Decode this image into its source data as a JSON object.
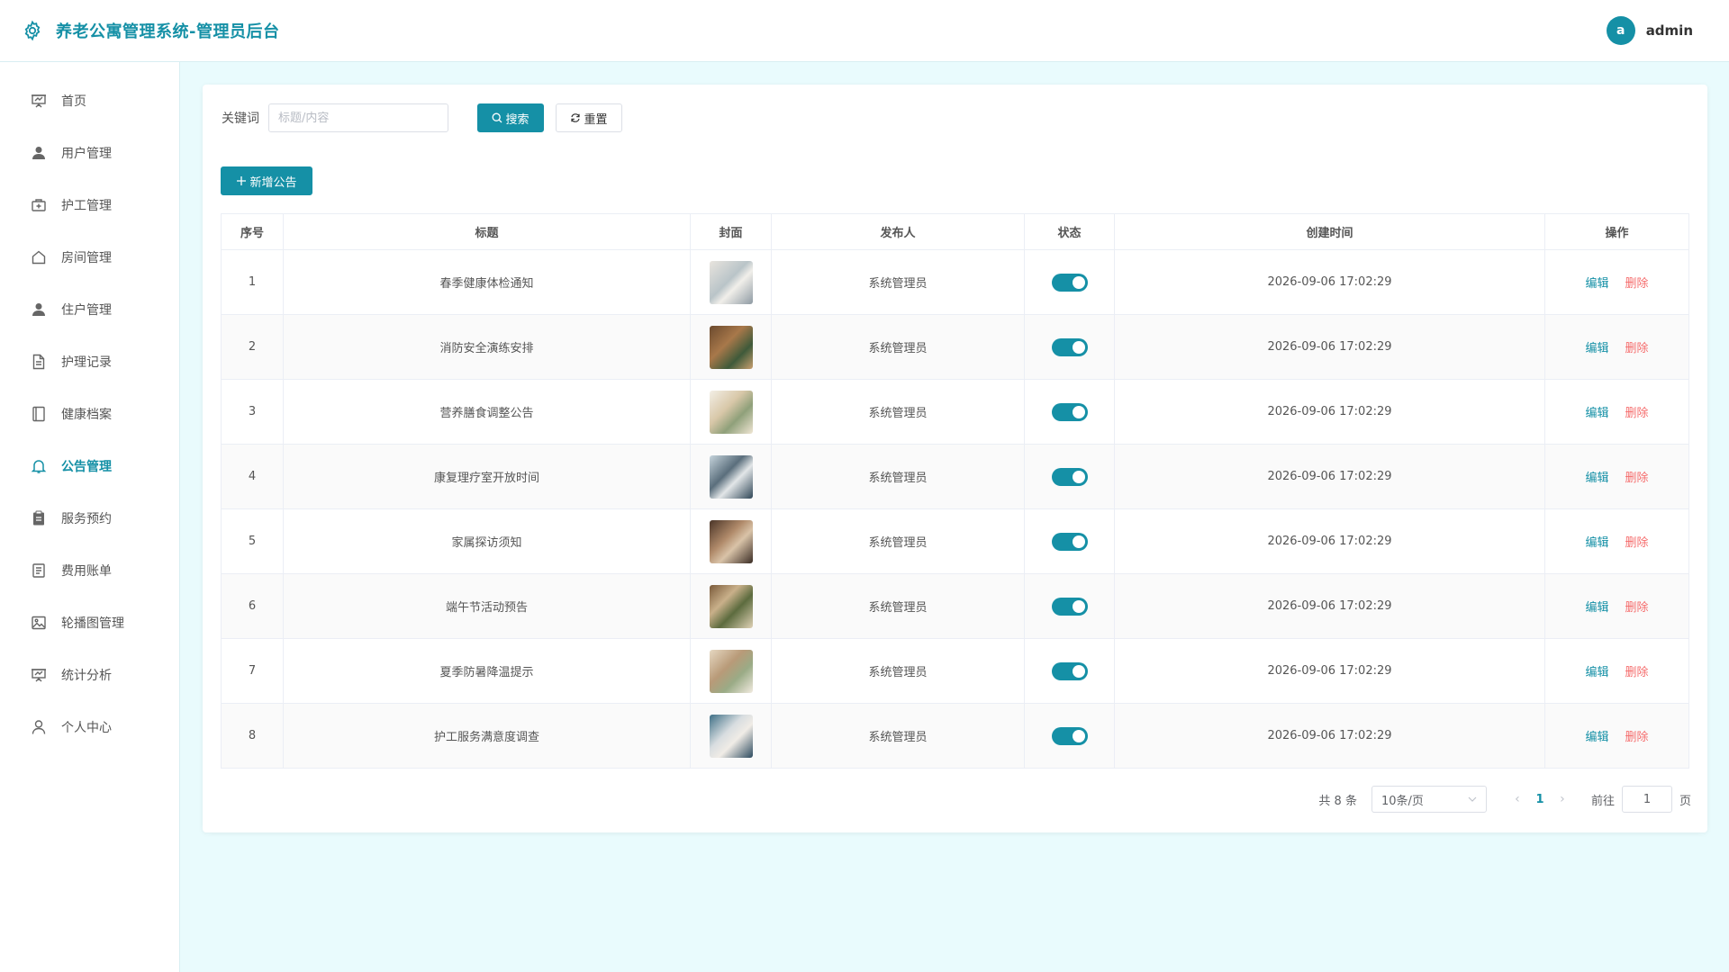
{
  "header": {
    "title": "养老公寓管理系统-管理员后台",
    "avatar_letter": "a",
    "username": "admin"
  },
  "sidebar": {
    "items": [
      {
        "label": "首页",
        "icon": "presentation-icon"
      },
      {
        "label": "用户管理",
        "icon": "user-icon"
      },
      {
        "label": "护工管理",
        "icon": "first-aid-kit-icon"
      },
      {
        "label": "房间管理",
        "icon": "house-icon"
      },
      {
        "label": "住户管理",
        "icon": "user-icon"
      },
      {
        "label": "护理记录",
        "icon": "document-icon"
      },
      {
        "label": "健康档案",
        "icon": "notebook-icon"
      },
      {
        "label": "公告管理",
        "icon": "bell-icon",
        "active": true
      },
      {
        "label": "服务预约",
        "icon": "clipboard-icon"
      },
      {
        "label": "费用账单",
        "icon": "tickets-icon"
      },
      {
        "label": "轮播图管理",
        "icon": "picture-icon"
      },
      {
        "label": "统计分析",
        "icon": "presentation-icon"
      },
      {
        "label": "个人中心",
        "icon": "user-outline-icon"
      }
    ]
  },
  "search": {
    "label": "关键词",
    "placeholder": "标题/内容",
    "search_button": "搜索",
    "reset_button": "重置"
  },
  "add_button": "新增公告",
  "table": {
    "columns": [
      "序号",
      "标题",
      "封面",
      "发布人",
      "状态",
      "创建时间",
      "操作"
    ],
    "edit_label": "编辑",
    "delete_label": "删除",
    "rows": [
      {
        "index": "1",
        "title": "春季健康体检通知",
        "publisher": "系统管理员",
        "status": true,
        "created": "2026-09-06 17:02:29"
      },
      {
        "index": "2",
        "title": "消防安全演练安排",
        "publisher": "系统管理员",
        "status": true,
        "created": "2026-09-06 17:02:29"
      },
      {
        "index": "3",
        "title": "营养膳食调整公告",
        "publisher": "系统管理员",
        "status": true,
        "created": "2026-09-06 17:02:29"
      },
      {
        "index": "4",
        "title": "康复理疗室开放时间",
        "publisher": "系统管理员",
        "status": true,
        "created": "2026-09-06 17:02:29"
      },
      {
        "index": "5",
        "title": "家属探访须知",
        "publisher": "系统管理员",
        "status": true,
        "created": "2026-09-06 17:02:29"
      },
      {
        "index": "6",
        "title": "端午节活动预告",
        "publisher": "系统管理员",
        "status": true,
        "created": "2026-09-06 17:02:29"
      },
      {
        "index": "7",
        "title": "夏季防暑降温提示",
        "publisher": "系统管理员",
        "status": true,
        "created": "2026-09-06 17:02:29"
      },
      {
        "index": "8",
        "title": "护工服务满意度调查",
        "publisher": "系统管理员",
        "status": true,
        "created": "2026-09-06 17:02:29"
      }
    ]
  },
  "pagination": {
    "total": "共 8 条",
    "page_size": "10条/页",
    "current_page": "1",
    "goto_label": "前往",
    "goto_value": "1",
    "unit": "页"
  },
  "colors": {
    "accent": "#1590a6",
    "danger": "#f56c6c",
    "background": "#e9fbfd"
  }
}
